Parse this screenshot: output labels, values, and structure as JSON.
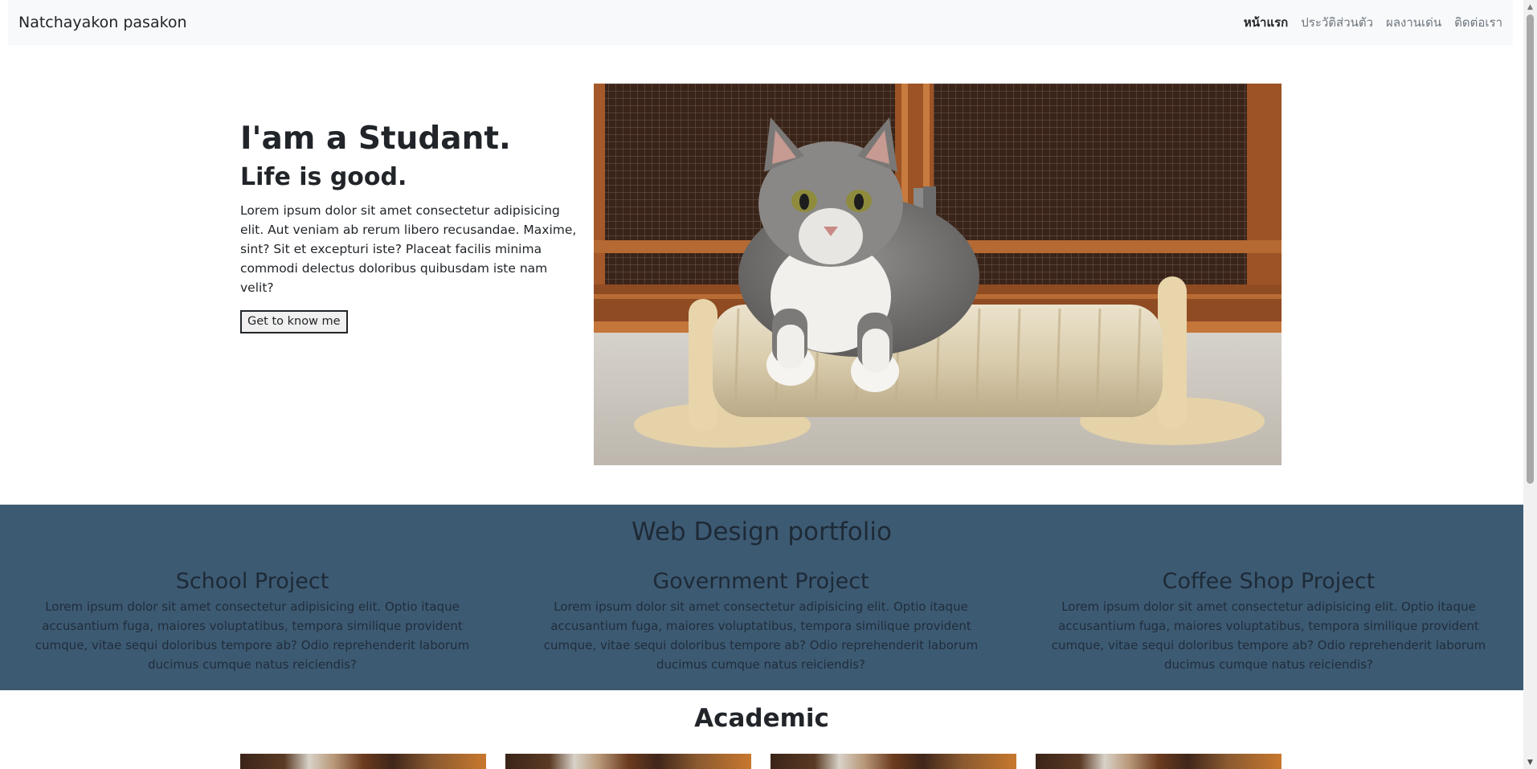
{
  "navbar": {
    "brand": "Natchayakon pasakon",
    "links": [
      "หน้าแรก",
      "ประวัติส่วนตัว",
      "ผลงานเด่น",
      "ติดต่อเรา"
    ]
  },
  "hero": {
    "title": "I'am a Studant.",
    "subtitle": "Life is good.",
    "paragraph": "Lorem ipsum dolor sit amet consectetur adipisicing elit. Aut veniam ab rerum libero recusandae. Maxime, sint? Sit et excepturi iste? Placeat facilis minima commodi delectus doloribus quibusdam iste nam velit?",
    "button": "Get to know me",
    "image_icon": "cat-photo"
  },
  "portfolio": {
    "title": "Web Design portfolio",
    "projects": [
      {
        "title": "School Project",
        "text": "Lorem ipsum dolor sit amet consectetur adipisicing elit. Optio itaque accusantium fuga, maiores voluptatibus, tempora similique provident cumque, vitae sequi doloribus tempore ab? Odio reprehenderit laborum ducimus cumque natus reiciendis?"
      },
      {
        "title": "Government Project",
        "text": "Lorem ipsum dolor sit amet consectetur adipisicing elit. Optio itaque accusantium fuga, maiores voluptatibus, tempora similique provident cumque, vitae sequi doloribus tempore ab? Odio reprehenderit laborum ducimus cumque natus reiciendis?"
      },
      {
        "title": "Coffee Shop Project",
        "text": "Lorem ipsum dolor sit amet consectetur adipisicing elit. Optio itaque accusantium fuga, maiores voluptatibus, tempora similique provident cumque, vitae sequi doloribus tempore ab? Odio reprehenderit laborum ducimus cumque natus reiciendis?"
      }
    ],
    "background_color": "#3d5a73"
  },
  "academic": {
    "title": "Academic"
  }
}
